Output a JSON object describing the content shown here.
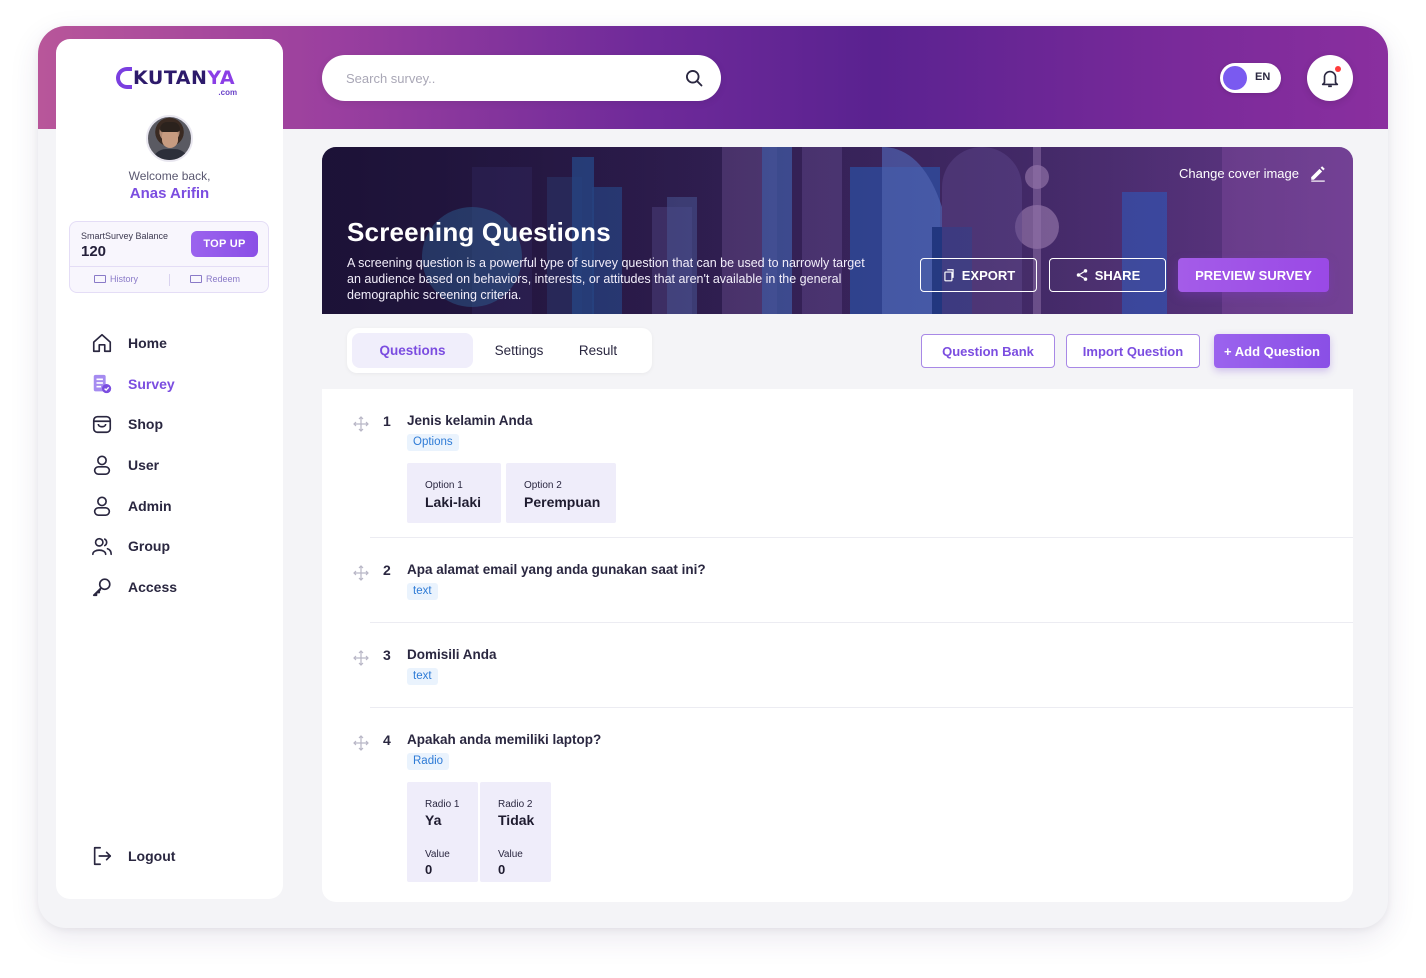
{
  "brand": {
    "name_main": "KUTAN",
    "name_accent": "YA",
    "suffix": ".com"
  },
  "user": {
    "welcome": "Welcome back,",
    "name": "Anas Arifin"
  },
  "balance": {
    "label": "SmartSurvey Balance",
    "value": "120",
    "topup_label": "TOP UP",
    "history_label": "History",
    "redeem_label": "Redeem"
  },
  "nav": [
    {
      "label": "Home",
      "icon": "home-icon"
    },
    {
      "label": "Survey",
      "icon": "survey-icon",
      "active": true
    },
    {
      "label": "Shop",
      "icon": "shop-icon"
    },
    {
      "label": "User",
      "icon": "user-icon"
    },
    {
      "label": "Admin",
      "icon": "admin-icon"
    },
    {
      "label": "Group",
      "icon": "group-icon"
    },
    {
      "label": "Access",
      "icon": "key-icon"
    }
  ],
  "logout_label": "Logout",
  "search": {
    "placeholder": "Search survey.."
  },
  "lang": "EN",
  "cover": {
    "change_label": "Change cover image",
    "title": "Screening Questions",
    "description": "A screening question is a powerful type of survey question that can be used to narrowly target an audience based on behaviors, interests, or attitudes that aren't available in the general demographic screening criteria."
  },
  "actions": {
    "export": "EXPORT",
    "share": "SHARE",
    "preview": "PREVIEW SURVEY"
  },
  "tabs": {
    "questions": "Questions",
    "settings": "Settings",
    "result": "Result"
  },
  "toolbar": {
    "question_bank": "Question Bank",
    "import": "Import Question",
    "add": "+ Add Question"
  },
  "questions": [
    {
      "num": "1",
      "title": "Jenis kelamin Anda",
      "type": "Options",
      "options": [
        {
          "label": "Option 1",
          "value": "Laki-laki"
        },
        {
          "label": "Option 2",
          "value": "Perempuan"
        }
      ]
    },
    {
      "num": "2",
      "title": "Apa alamat email yang anda gunakan saat ini?",
      "type": "text"
    },
    {
      "num": "3",
      "title": "Domisili Anda",
      "type": "text"
    },
    {
      "num": "4",
      "title": "Apakah anda memiliki laptop?",
      "type": "Radio",
      "options": [
        {
          "label": "Radio 1",
          "value": "Ya",
          "value_label": "Value",
          "score": "0"
        },
        {
          "label": "Radio 2",
          "value": "Tidak",
          "value_label": "Value",
          "score": "0"
        }
      ]
    }
  ],
  "colors": {
    "accent": "#7b4de0",
    "brand_gradient_start": "#b8569a",
    "brand_gradient_end": "#5a2290"
  }
}
